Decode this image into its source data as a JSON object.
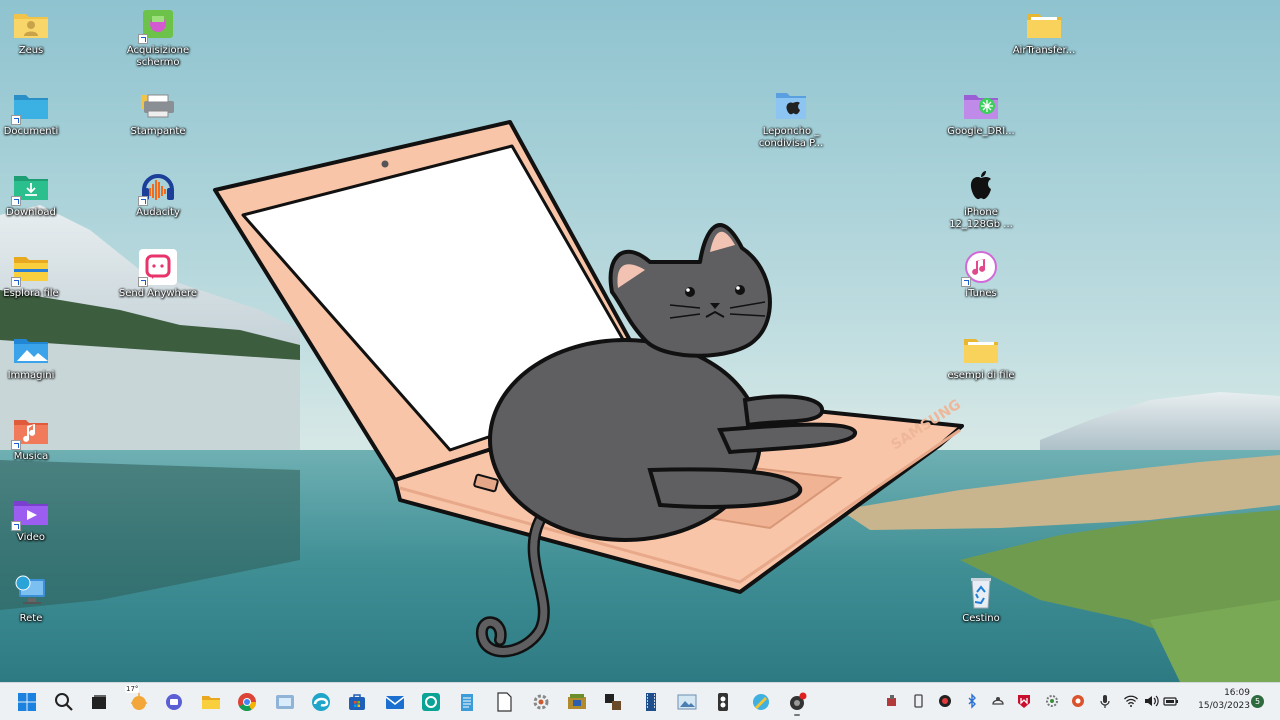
{
  "desktop": {
    "icons": [
      {
        "label": "Zeus",
        "icon": "user-folder-icon"
      },
      {
        "label": "Documenti",
        "icon": "documents-folder-icon"
      },
      {
        "label": "Download",
        "icon": "downloads-folder-icon"
      },
      {
        "label": "Esplora file",
        "icon": "file-explorer-icon"
      },
      {
        "label": "Immagini",
        "icon": "pictures-folder-icon"
      },
      {
        "label": "Musica",
        "icon": "music-folder-icon"
      },
      {
        "label": "Video",
        "icon": "videos-folder-icon"
      },
      {
        "label": "Rete",
        "icon": "network-icon"
      },
      {
        "label": "Acquisizione schermo",
        "icon": "screen-capture-icon"
      },
      {
        "label": "Stampante",
        "icon": "printer-icon"
      },
      {
        "label": "Audacity",
        "icon": "audacity-icon"
      },
      {
        "label": "Send Anywhere",
        "icon": "send-anywhere-icon"
      },
      {
        "label": "Leponcho _ condivisa P...",
        "icon": "mac-shared-folder-icon"
      },
      {
        "label": "Google_DRI...",
        "icon": "google-drive-folder-icon"
      },
      {
        "label": "iPhone 12_128Gb ...",
        "icon": "apple-icon"
      },
      {
        "label": "iTunes",
        "icon": "itunes-icon"
      },
      {
        "label": "esempi di file",
        "icon": "folder-icon"
      },
      {
        "label": "Cestino",
        "icon": "recycle-bin-icon"
      },
      {
        "label": "AirTransfer...",
        "icon": "folder-icon"
      }
    ],
    "brand_on_laptop": "SAMSUNG"
  },
  "taskbar": {
    "apps": [
      {
        "name": "Start",
        "icon": "windows-start-icon"
      },
      {
        "name": "Search",
        "icon": "search-icon"
      },
      {
        "name": "Task View",
        "icon": "task-view-icon"
      },
      {
        "name": "Weather",
        "icon": "weather-icon"
      },
      {
        "name": "Teams Chat",
        "icon": "chat-icon"
      },
      {
        "name": "File Explorer",
        "icon": "file-explorer-icon"
      },
      {
        "name": "Chrome",
        "icon": "chrome-icon"
      },
      {
        "name": "Snipping",
        "icon": "capture-icon"
      },
      {
        "name": "Edge",
        "icon": "edge-icon"
      },
      {
        "name": "Store",
        "icon": "store-icon"
      },
      {
        "name": "Mail",
        "icon": "mail-icon"
      },
      {
        "name": "App",
        "icon": "teal-app-icon"
      },
      {
        "name": "Notepad",
        "icon": "notepad-icon"
      },
      {
        "name": "Document",
        "icon": "document-icon"
      },
      {
        "name": "Settings",
        "icon": "settings-app-icon"
      },
      {
        "name": "Archive",
        "icon": "archive-icon"
      },
      {
        "name": "Tools",
        "icon": "tools-icon"
      },
      {
        "name": "Film",
        "icon": "film-icon"
      },
      {
        "name": "Photo",
        "icon": "photo-icon"
      },
      {
        "name": "Calculator",
        "icon": "calculator-icon"
      },
      {
        "name": "Pencil",
        "icon": "pencil-app-icon"
      },
      {
        "name": "Recorder",
        "icon": "record-icon"
      }
    ],
    "weather_temp": "17°",
    "tray_icons": [
      "usb-icon",
      "phone-icon",
      "app-red-icon",
      "bluetooth-icon",
      "teams-icon",
      "network-share-icon",
      "mcafee-icon",
      "settings-icon",
      "app-orange-icon",
      "microphone-icon",
      "wifi-icon",
      "volume-icon",
      "battery-icon"
    ],
    "time": "16:09",
    "date": "15/03/2023",
    "notifications": "5"
  }
}
